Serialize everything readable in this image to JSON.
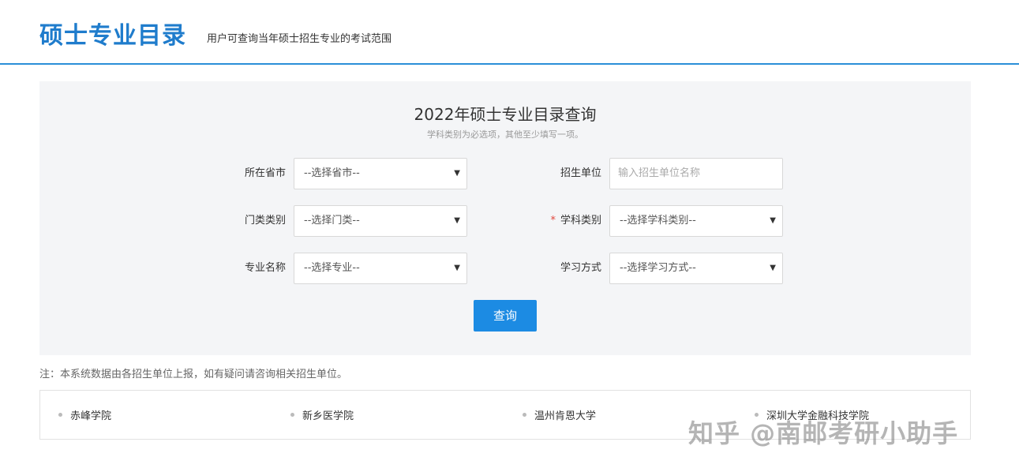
{
  "header": {
    "brand": "硕士专业目录",
    "slogan": "用户可查询当年硕士招生专业的考试范围"
  },
  "search": {
    "title": "2022年硕士专业目录查询",
    "subtitle": "学科类别为必选项，其他至少填写一项。",
    "province_label": "所在省市",
    "province_value": "--选择省市--",
    "unit_label": "招生单位",
    "unit_placeholder": "输入招生单位名称",
    "category_label": "门类类别",
    "category_value": "--选择门类--",
    "discipline_required_mark": "*",
    "discipline_label": "学科类别",
    "discipline_value": "--选择学科类别--",
    "major_label": "专业名称",
    "major_value": "--选择专业--",
    "study_mode_label": "学习方式",
    "study_mode_value": "--选择学习方式--",
    "query_button": "查询"
  },
  "note": "注：本系统数据由各招生单位上报，如有疑问请咨询相关招生单位。",
  "schools": [
    "赤峰学院",
    "新乡医学院",
    "温州肯恩大学",
    "深圳大学金融科技学院"
  ],
  "watermark": "知乎 @南邮考研小助手",
  "icons": {
    "dropdown": "caret-down-icon",
    "bullet": "bullet-dot-icon"
  },
  "colors": {
    "brand": "#1f7ccc",
    "button": "#1c8be3",
    "required": "#e2463c",
    "header_rule": "#2b8fd8"
  }
}
